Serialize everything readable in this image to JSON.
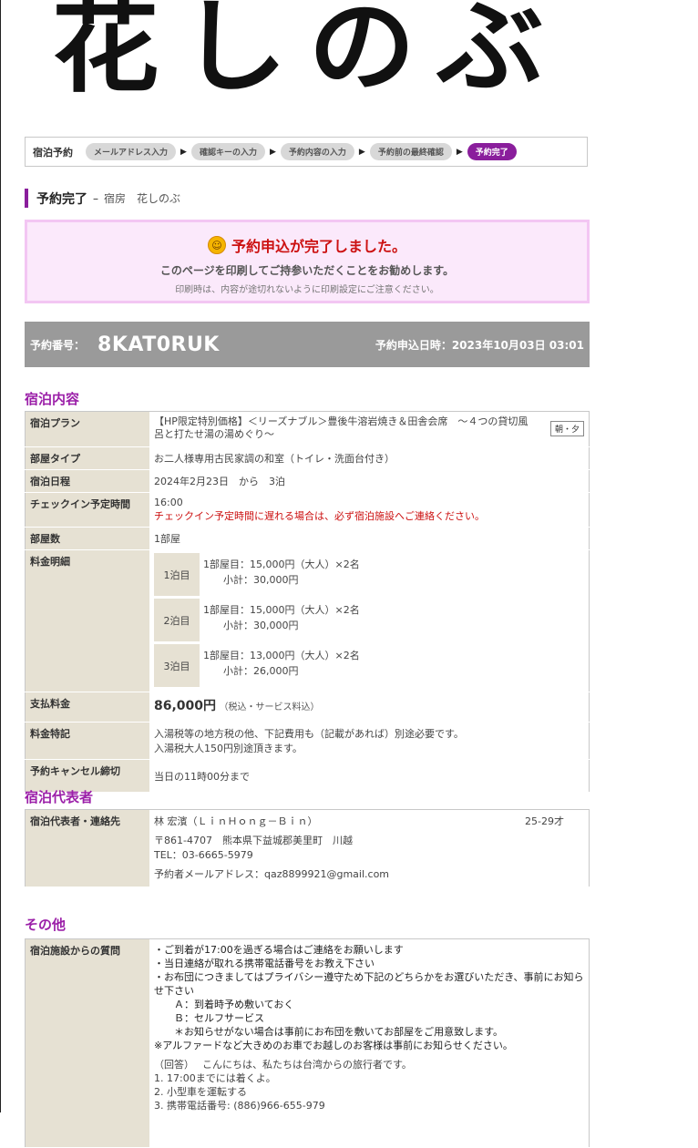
{
  "logo_text": "花しのぶ",
  "steps": {
    "label": "宿泊予約",
    "items": [
      "メールアドレス入力",
      "確認キーの入力",
      "予約内容の入力",
      "予約前の最終確認",
      "予約完了"
    ],
    "arrow": "▶"
  },
  "title": {
    "main": "予約完了",
    "dash": "–",
    "sub": "宿房　花しのぶ"
  },
  "notice": {
    "icon": "smiley-icon",
    "main": "予約申込が完了しました。",
    "line1": "このページを印刷してご持参いただくことをお勧めします。",
    "line2": "印刷時は、内容が途切れないように印刷設定にご注意ください。"
  },
  "reservation": {
    "number_label": "予約番号：",
    "number": "8KAT0RUK",
    "date_text": "予約申込日時：2023年10月03日 03:01"
  },
  "stay": {
    "heading": "宿泊内容",
    "plan_label": "宿泊プラン",
    "plan": "【HP限定特別価格】＜リーズナブル＞豊後牛溶岩焼き＆田舎会席　～４つの貸切風呂と打たせ湯の湯めぐり～",
    "meal_badge": "朝・夕",
    "room_label": "部屋タイプ",
    "room": "お二人様専用古民家調の和室（トイレ・洗面台付き）",
    "date_label": "宿泊日程",
    "date": "2024年2月23日　から　3泊",
    "checkin_label": "チェックイン予定時間",
    "checkin": "16:00",
    "checkin_note": "チェックイン予定時間に遅れる場合は、必ず宿泊施設へご連絡ください。",
    "rooms_label": "部屋数",
    "rooms": "1部屋",
    "price_label": "料金明細",
    "nights": [
      {
        "label": "1泊目",
        "line1": "1部屋目：15,000円（大人）×2名",
        "line2": "　　小計：30,000円"
      },
      {
        "label": "2泊目",
        "line1": "1部屋目：15,000円（大人）×2名",
        "line2": "　　小計：30,000円"
      },
      {
        "label": "3泊目",
        "line1": "1部屋目：13,000円（大人）×2名",
        "line2": "　　小計：26,000円"
      }
    ],
    "total_label": "支払料金",
    "total": "86,000円",
    "total_note": "（税込・サービス料込）",
    "special_label": "料金特記",
    "special1": "入湯税等の地方税の他、下記費用も（記載があれば）別途必要です。",
    "special2": "入湯税大人150円別途頂きます。",
    "cancel_label": "予約キャンセル締切",
    "cancel": "当日の11時00分まで"
  },
  "guest": {
    "heading": "宿泊代表者",
    "label": "宿泊代表者・連絡先",
    "name": "林 宏濱（ＬｉｎＨｏｎｇ－Ｂｉｎ）",
    "age": "25-29才",
    "address": "〒861-4707　熊本県下益城郡美里町　川越",
    "tel": "TEL：03-6665-5979",
    "email": "予約者メールアドレス：qaz8899921@gmail.com"
  },
  "other": {
    "heading": "その他",
    "label": "宿泊施設からの質問",
    "question": "・ご到着が17:00を過ぎる場合はご連絡をお願いします\n・当日連絡が取れる携帯電話番号をお教え下さい\n・お布団につきましてはプライバシー遵守ため下記のどちらかをお選びいただき、事前にお知らせ下さい\n　　Ａ：到着時予め敷いておく\n　　Ｂ：セルフサービス\n　　＊お知らせがない場合は事前にお布団を敷いてお部屋をご用意致します。\n※アルファードなど大きめのお車でお越しのお客様は事前にお知らせください。",
    "answer": "（回答）　 こんにちは、私たちは台湾からの旅行者です。\n1. 17:00までには着くよ。\n2. 小型車を運転する\n3. 携帯電話番号: (886)966-655-979"
  }
}
